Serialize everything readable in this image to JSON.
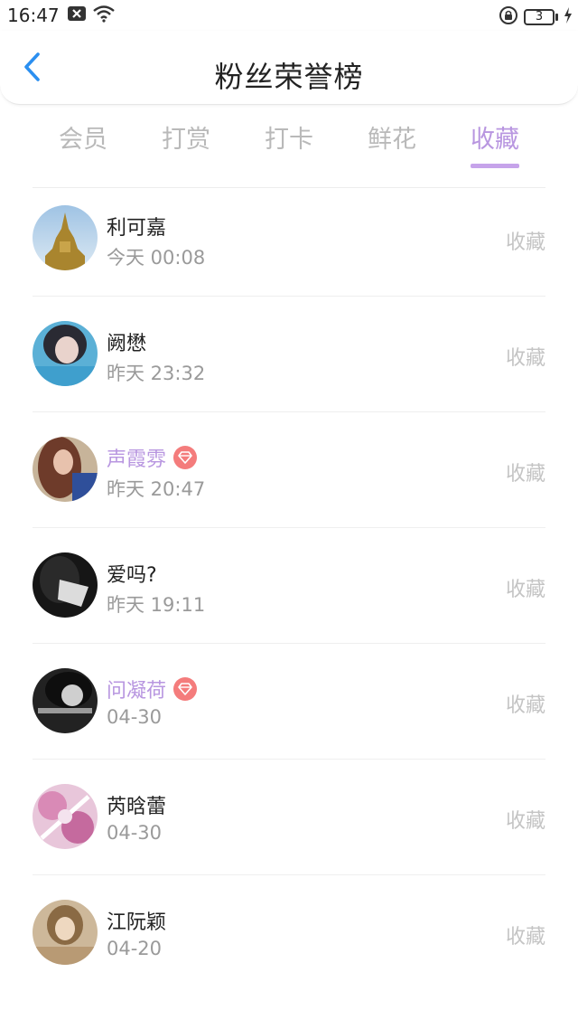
{
  "status_bar": {
    "time": "16:47",
    "battery_level": "3",
    "icons": [
      "notification-close-icon",
      "wifi-icon",
      "lock-rotation-icon",
      "battery-icon",
      "charging-icon"
    ]
  },
  "header": {
    "title": "粉丝荣誉榜",
    "back_icon": "chevron-left-icon",
    "accent": "#2b8ff0"
  },
  "tabs": [
    {
      "label": "会员",
      "active": false
    },
    {
      "label": "打赏",
      "active": false
    },
    {
      "label": "打卡",
      "active": false
    },
    {
      "label": "鲜花",
      "active": false
    },
    {
      "label": "收藏",
      "active": true
    }
  ],
  "colors": {
    "active_tab": "#b896e0",
    "vip_name": "#b896e0",
    "vip_badge": "#f47c7c",
    "muted": "#c4c4c4"
  },
  "users": [
    {
      "name": "利可嘉",
      "time": "今天 00:08",
      "action": "收藏",
      "vip": false
    },
    {
      "name": "阙懋",
      "time": "昨天 23:32",
      "action": "收藏",
      "vip": false
    },
    {
      "name": "声霞雰",
      "time": "昨天 20:47",
      "action": "收藏",
      "vip": true
    },
    {
      "name": "爱吗?",
      "time": "昨天 19:11",
      "action": "收藏",
      "vip": false
    },
    {
      "name": "问凝荷",
      "time": "04-30",
      "action": "收藏",
      "vip": true
    },
    {
      "name": "芮晗蕾",
      "time": "04-30",
      "action": "收藏",
      "vip": false
    },
    {
      "name": "江阮颖",
      "time": "04-20",
      "action": "收藏",
      "vip": false
    }
  ]
}
